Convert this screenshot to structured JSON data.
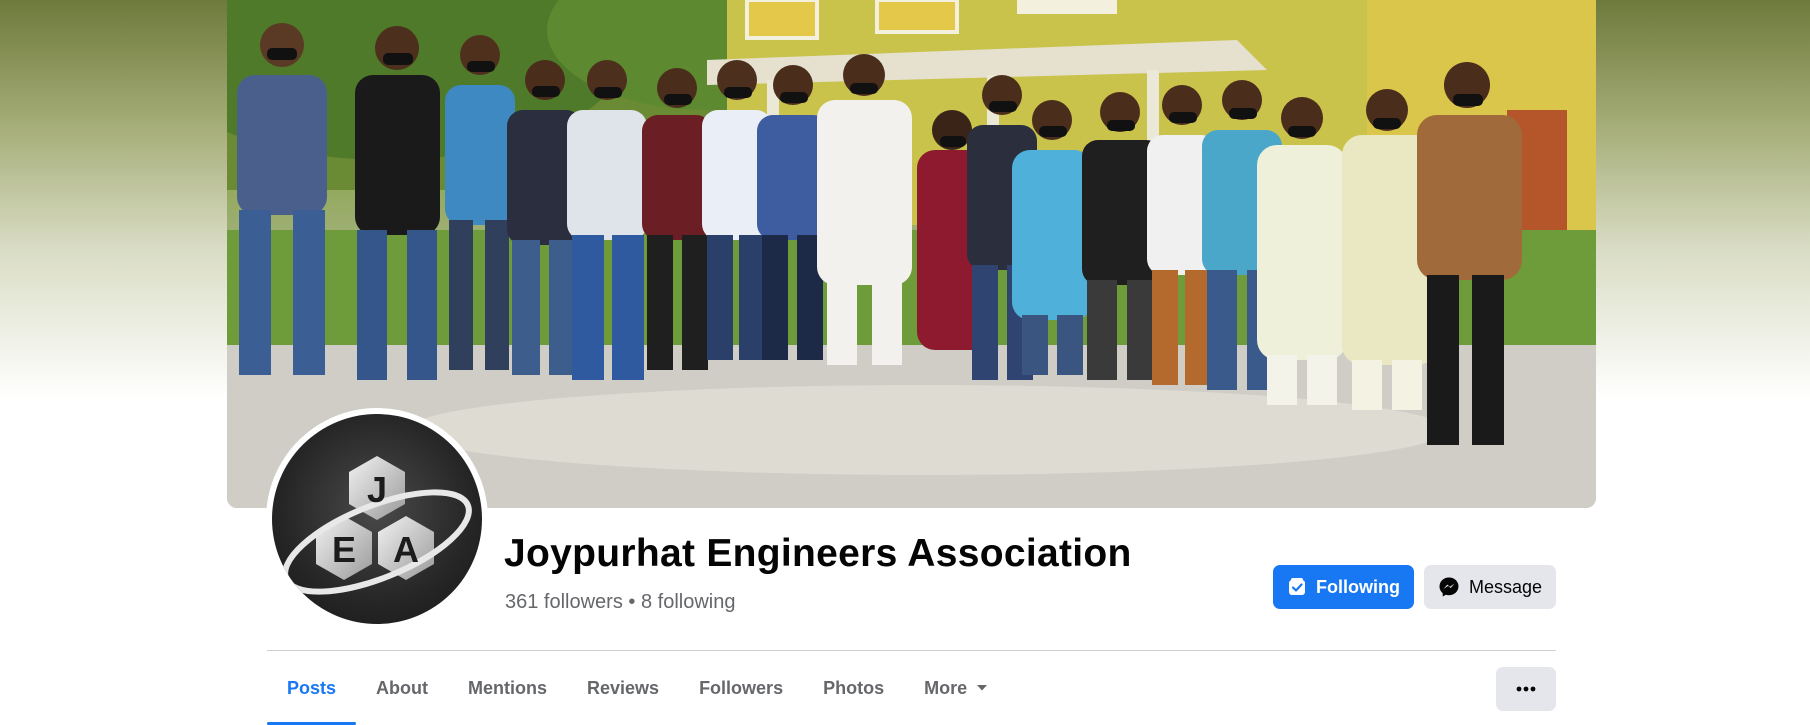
{
  "page": {
    "name": "Joypurhat Engineers Association",
    "followers_text": "361 followers",
    "separator": "•",
    "following_text": "8 following"
  },
  "avatar": {
    "logo_letters": [
      "J",
      "E",
      "A"
    ]
  },
  "actions": {
    "following_label": "Following",
    "message_label": "Message"
  },
  "tabs": [
    {
      "label": "Posts",
      "active": true
    },
    {
      "label": "About"
    },
    {
      "label": "Mentions"
    },
    {
      "label": "Reviews"
    },
    {
      "label": "Followers"
    },
    {
      "label": "Photos"
    },
    {
      "label": "More"
    }
  ],
  "icons": {
    "following": "following-icon",
    "message": "messenger-icon",
    "more": "caret-down-icon",
    "options": "more-dots-icon"
  },
  "colors": {
    "accent": "#1877f2",
    "secondary_button": "#e4e6eb",
    "muted_text": "#65676b"
  }
}
